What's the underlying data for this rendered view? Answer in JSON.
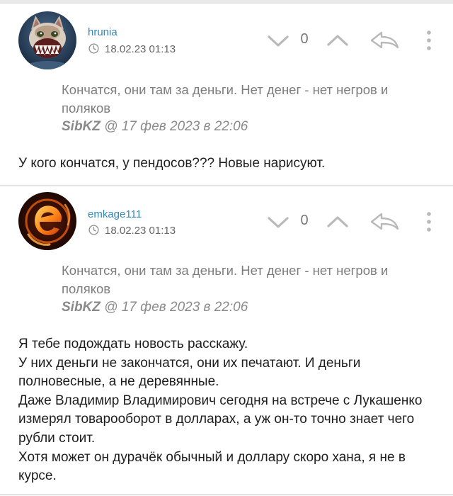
{
  "comments": [
    {
      "username": "hrunia",
      "datetime": "18.02.23 01:13",
      "score": "0",
      "quote_text": "Кончатся, они там за деньги. Нет денег - нет негров и поляков",
      "quote_author": "SibKZ",
      "quote_date": " @ 17 фев 2023 в 22:06",
      "body": "У кого кончатся, у пендосов??? Новые нарисуют."
    },
    {
      "username": "emkage111",
      "datetime": "18.02.23 01:13",
      "score": "0",
      "quote_text": "Кончатся, они там за деньги. Нет денег - нет негров и поляков",
      "quote_author": "SibKZ",
      "quote_date": " @ 17 фев 2023 в 22:06",
      "body": "Я тебе подождать новость расскажу.\nУ них деньги не закончатся, они их печатают. И деньги полновесные, а не деревянные.\nДаже Владимир Владимирович сегодня на встрече с Лукашенко измерял товарооборот в долларах, а уж он-то точно знает чего рубли стоит.\nХотя может он дурачёк обычный и доллару скоро хана, я не в курсе."
    }
  ],
  "colors": {
    "username": "#2f86b7",
    "icon": "#b9b9b9",
    "quote": "#7d7d7d"
  },
  "icons": {
    "vote_down": "chevron-down-icon",
    "vote_up": "chevron-up-icon",
    "reply": "reply-arrow-icon",
    "more": "vertical-dots-icon",
    "time": "clock-icon"
  }
}
